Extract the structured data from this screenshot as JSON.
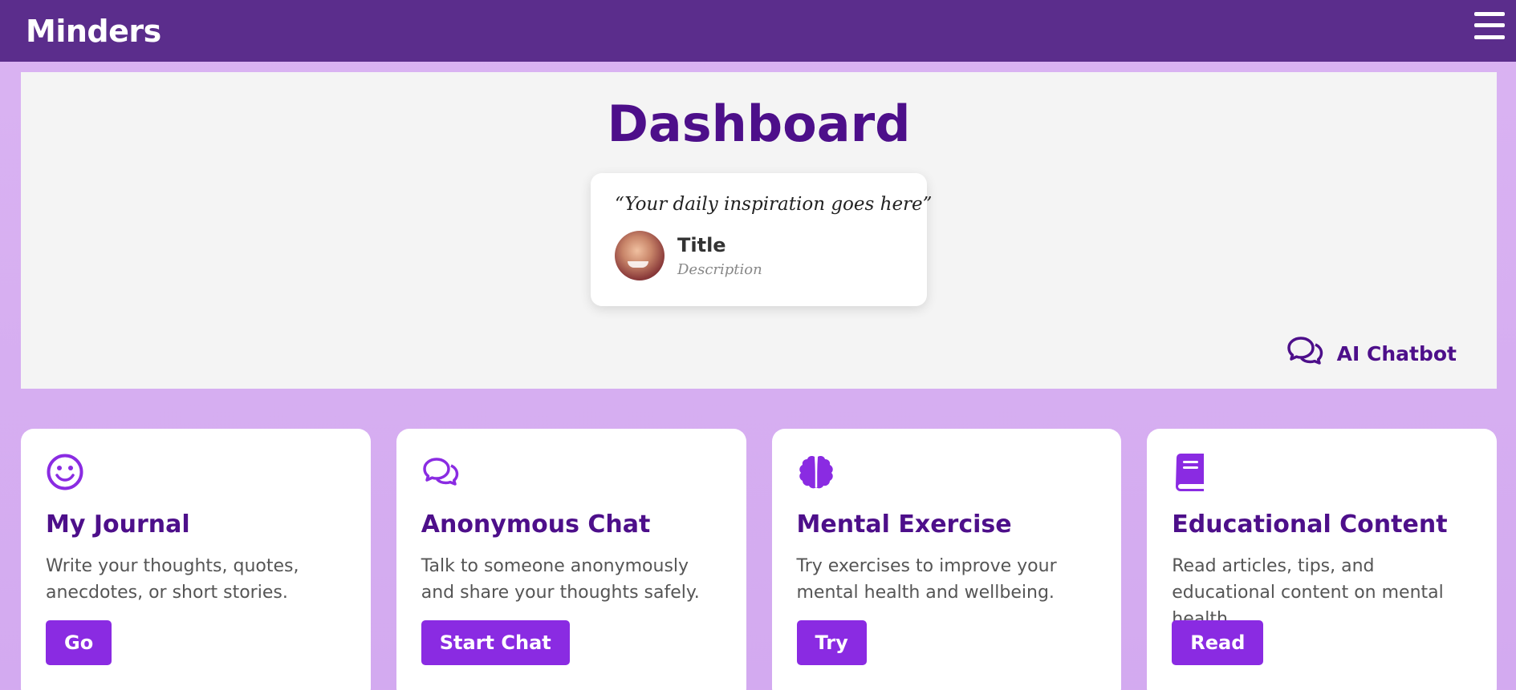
{
  "navbar": {
    "brand": "Minders",
    "menu_icon": "hamburger-menu-icon"
  },
  "hero": {
    "title": "Dashboard",
    "quote": {
      "text": "“Your daily inspiration goes here”",
      "author_title": "Title",
      "author_description": "Description"
    },
    "chatbot_label": "AI Chatbot",
    "chatbot_icon": "chat-bubbles-icon"
  },
  "cards": [
    {
      "icon": "smiley-icon",
      "title": "My Journal",
      "description": "Write your thoughts, quotes, anecdotes, or short stories.",
      "button": "Go"
    },
    {
      "icon": "chat-bubbles-icon",
      "title": "Anonymous Chat",
      "description": "Talk to someone anonymously and share your thoughts safely.",
      "button": "Start Chat"
    },
    {
      "icon": "brain-icon",
      "title": "Mental Exercise",
      "description": "Try exercises to improve your mental health and wellbeing.",
      "button": "Try"
    },
    {
      "icon": "book-icon",
      "title": "Educational Content",
      "description": "Read articles, tips, and educational content on mental health.",
      "button": "Read"
    }
  ],
  "colors": {
    "navbar": "#5b2d8c",
    "accent": "#8a2be2",
    "heading": "#4d0f8a",
    "background": "#dab3f2"
  }
}
